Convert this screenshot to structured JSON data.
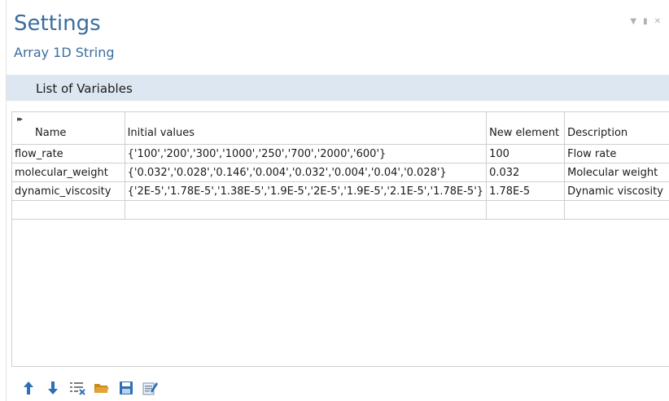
{
  "header": {
    "title": "Settings",
    "subtitle": "Array 1D String"
  },
  "section": {
    "label": "List of Variables"
  },
  "table": {
    "columns": [
      "Name",
      "Initial values",
      "New element",
      "Description"
    ],
    "rows": [
      [
        "flow_rate",
        "{'100','200','300','1000','250','700','2000','600'}",
        "100",
        "Flow rate"
      ],
      [
        "molecular_weight",
        "{'0.032','0.028','0.146','0.004','0.032','0.004','0.04','0.028'}",
        "0.032",
        "Molecular weight"
      ],
      [
        "dynamic_viscosity",
        "{'2E-5','1.78E-5','1.38E-5','1.9E-5','2E-5','1.9E-5','2.1E-5','1.78E-5'}",
        "1.78E-5",
        "Dynamic viscosity"
      ],
      [
        "",
        "",
        "",
        ""
      ]
    ]
  },
  "toolbar": {
    "icons": [
      "move-up-icon",
      "move-down-icon",
      "clear-table-icon",
      "open-file-icon",
      "save-icon",
      "edit-icon"
    ]
  },
  "colors": {
    "accent": "#3a6d9e",
    "section_bg": "#dde7f1",
    "icon_blue": "#2f6fb5",
    "folder": "#e2a33a"
  }
}
